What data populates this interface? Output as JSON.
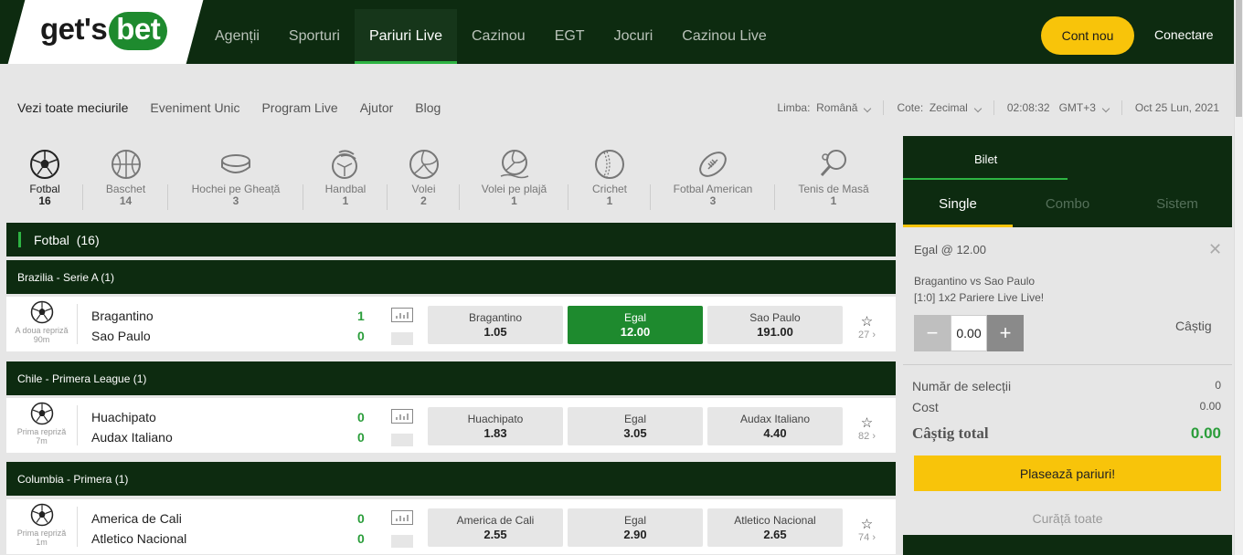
{
  "header": {
    "logo": {
      "part1": "get",
      "part2": "'s",
      "part3": "bet"
    },
    "nav": [
      "Agenții",
      "Sporturi",
      "Pariuri Live",
      "Cazinou",
      "EGT",
      "Jocuri",
      "Cazinou Live"
    ],
    "active_nav": "Pariuri Live",
    "new_account": "Cont nou",
    "login": "Conectare"
  },
  "subnav": [
    "Vezi toate meciurile",
    "Eveniment Unic",
    "Program Live",
    "Ajutor",
    "Blog"
  ],
  "settings": {
    "lang_label": "Limba:",
    "lang_value": "Română",
    "odds_label": "Cote:",
    "odds_value": "Zecimal",
    "time": "02:08:32",
    "tz": "GMT+3",
    "date": "Oct 25 Lun, 2021"
  },
  "sports": [
    {
      "name": "Fotbal",
      "count": "16",
      "icon": "football-icon"
    },
    {
      "name": "Baschet",
      "count": "14",
      "icon": "basketball-icon"
    },
    {
      "name": "Hochei pe Gheață",
      "count": "3",
      "icon": "hockey-puck-icon"
    },
    {
      "name": "Handbal",
      "count": "1",
      "icon": "handball-icon"
    },
    {
      "name": "Volei",
      "count": "2",
      "icon": "volleyball-icon"
    },
    {
      "name": "Volei pe plajă",
      "count": "1",
      "icon": "beach-volleyball-icon"
    },
    {
      "name": "Crichet",
      "count": "1",
      "icon": "cricket-ball-icon"
    },
    {
      "name": "Fotbal American",
      "count": "3",
      "icon": "american-football-icon"
    },
    {
      "name": "Tenis de Masă",
      "count": "1",
      "icon": "table-tennis-icon"
    }
  ],
  "section": {
    "title": "Fotbal",
    "count": "(16)"
  },
  "leagues": [
    {
      "name": "Brazilia - Serie A (1)",
      "match": {
        "phase": "A doua repriză",
        "minute": "90m",
        "home": "Bragantino",
        "away": "Sao Paulo",
        "home_score": "1",
        "away_score": "0",
        "odds": [
          {
            "label": "Bragantino",
            "value": "1.05"
          },
          {
            "label": "Egal",
            "value": "12.00"
          },
          {
            "label": "Sao Paulo",
            "value": "191.00"
          }
        ],
        "more": "27"
      }
    },
    {
      "name": "Chile - Primera League (1)",
      "match": {
        "phase": "Prima repriză",
        "minute": "7m",
        "home": "Huachipato",
        "away": "Audax Italiano",
        "home_score": "0",
        "away_score": "0",
        "odds": [
          {
            "label": "Huachipato",
            "value": "1.83"
          },
          {
            "label": "Egal",
            "value": "3.05"
          },
          {
            "label": "Audax Italiano",
            "value": "4.40"
          }
        ],
        "more": "82"
      }
    },
    {
      "name": "Columbia - Primera (1)",
      "match": {
        "phase": "Prima repriză",
        "minute": "1m",
        "home": "America de Cali",
        "away": "Atletico Nacional",
        "home_score": "0",
        "away_score": "0",
        "odds": [
          {
            "label": "America de Cali",
            "value": "2.55"
          },
          {
            "label": "Egal",
            "value": "2.90"
          },
          {
            "label": "Atletico Nacional",
            "value": "2.65"
          }
        ],
        "more": "74"
      }
    }
  ],
  "betslip": {
    "title": "Bilet",
    "tabs": [
      "Single",
      "Combo",
      "Sistem"
    ],
    "selection": "Egal @ 12.00",
    "event": "Bragantino vs Sao Paulo",
    "market": "[1:0] 1x2 Pariere Live Live!",
    "stake": "0.00",
    "win_label": "Câștig",
    "num_selections_label": "Număr de selecții",
    "num_selections": "0",
    "cost_label": "Cost",
    "cost": "0.00",
    "total_win_label": "Câștig total",
    "total_win": "0.00",
    "place_bet": "Plasează pariuri!",
    "clear_all": "Curăță toate"
  },
  "colors": {
    "dark_green": "#0d2b10",
    "accent_green": "#2eb443",
    "odd_selected": "#1e8a2e",
    "yellow": "#f8c40a"
  }
}
